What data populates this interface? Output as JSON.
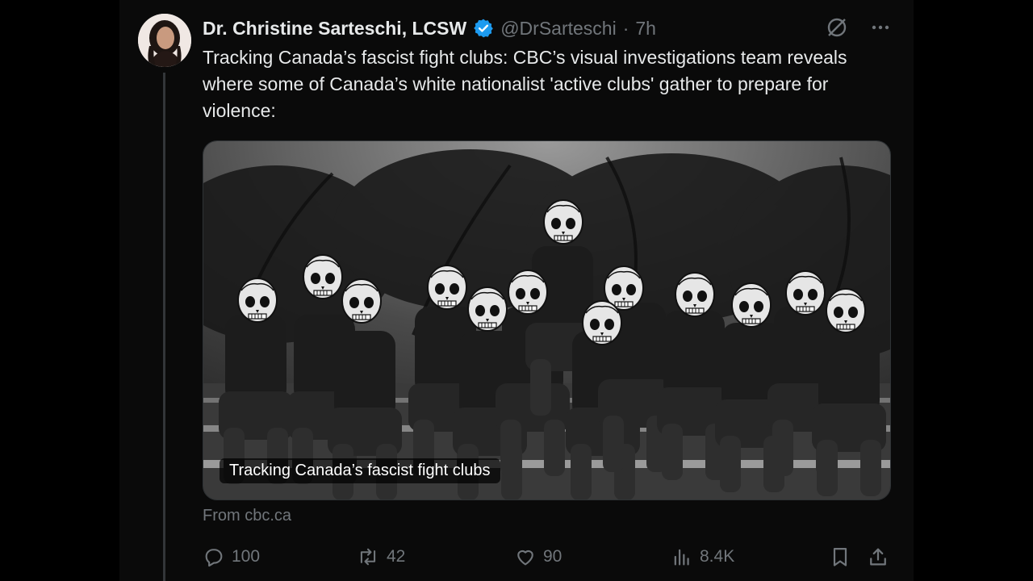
{
  "author": {
    "name": "Dr. Christine Sarteschi, LCSW",
    "handle": "@DrSarteschi",
    "separator": "·",
    "time": "7h",
    "verified": true
  },
  "tweet": {
    "text": "Tracking Canada’s fascist fight clubs: CBC’s visual investigations team reveals where some of Canada’s white nationalist 'active clubs' gather to prepare for violence:"
  },
  "card": {
    "label": "Tracking Canada’s fascist fight clubs",
    "source": "From cbc.ca"
  },
  "actions": {
    "replies": "100",
    "reposts": "42",
    "likes": "90",
    "views": "8.4K"
  },
  "colors": {
    "background": "#000000",
    "column": "#0a0a0a",
    "text": "#e7e9ea",
    "muted": "#71767b",
    "verified": "#1d9bf0"
  },
  "icons": [
    "grok-icon",
    "more-icon",
    "reply-icon",
    "repost-icon",
    "like-icon",
    "views-icon",
    "bookmark-icon",
    "share-icon",
    "verified-badge-icon"
  ]
}
